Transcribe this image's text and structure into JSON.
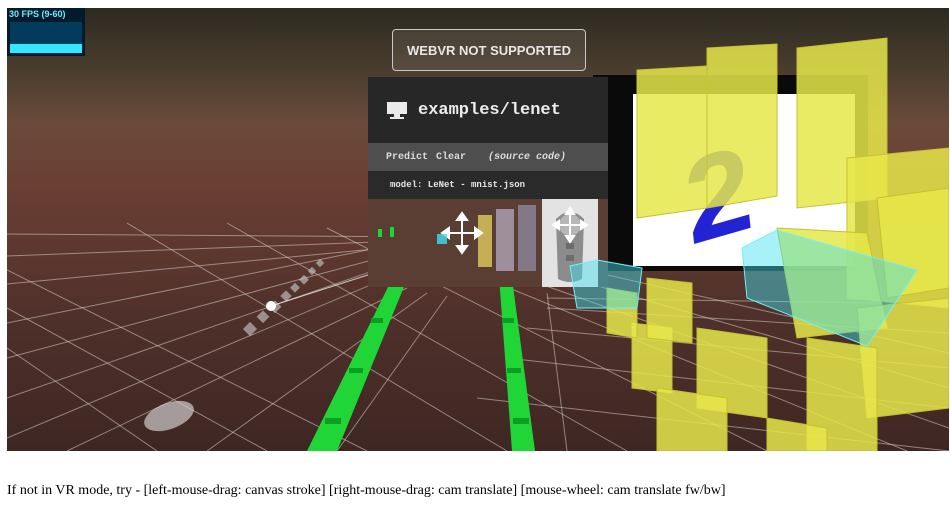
{
  "fps": {
    "label": "30 FPS (9-60)"
  },
  "webvr_button": {
    "label": "WEBVR NOT SUPPORTED"
  },
  "panel": {
    "title": "examples/lenet",
    "actions": {
      "predict": "Predict",
      "clear": "Clear",
      "source": "(source code)"
    },
    "model_label": "model: LeNet - mnist.json"
  },
  "canvas": {
    "digit": "2"
  },
  "instructions": "If not in VR mode, try - [left-mouse-drag: canvas stroke] [right-mouse-drag: cam translate] [mouse-wheel: cam translate fw/bw]",
  "colors": {
    "accent_green": "#1fd636",
    "cube_cyan": "#3fe0ef",
    "feature_yellow": "#e6e84a",
    "digit_blue": "#2323d6"
  },
  "icons": [
    "monitor-icon",
    "move-arrows-icon",
    "vr-controller-icon"
  ]
}
